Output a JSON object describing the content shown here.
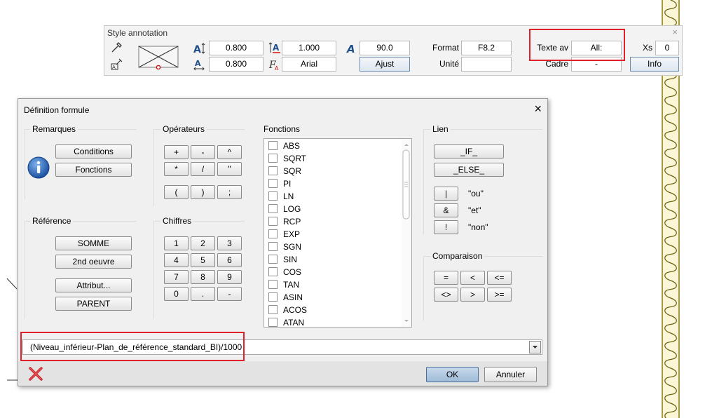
{
  "colors": {
    "highlight": "#e0202a",
    "wave": "#d8c43a",
    "primary_button": "#9fbcd8"
  },
  "style_toolbar": {
    "title": "Style annotation",
    "close_label": "×",
    "text_height": "0.800",
    "text_width": "0.800",
    "line_spacing": "1.000",
    "font": "Arial",
    "angle": "90.0",
    "adjust_button": "Ajust",
    "format_label": "Format",
    "format_value": "F8.2",
    "unit_label": "Unité",
    "unit_value": "",
    "text_before_label": "Texte av",
    "text_before_value": "All:",
    "frame_label": "Cadre",
    "frame_value": "-",
    "xs_label": "Xs",
    "xs_value": "0",
    "info_button": "Info"
  },
  "dialog": {
    "title": "Définition formule",
    "close_label": "×",
    "remarks": {
      "label": "Remarques",
      "conditions_button": "Conditions",
      "functions_button": "Fonctions",
      "info_icon": "info-icon"
    },
    "reference": {
      "label": "Référence",
      "sum_button": "SOMME",
      "second_work_button": "2nd oeuvre",
      "attribute_button": "Attribut...",
      "parent_button": "PARENT"
    },
    "operators": {
      "label": "Opérateurs",
      "buttons": [
        "+",
        "-",
        "^",
        "*",
        "/",
        "\"",
        "(",
        ")",
        ";"
      ]
    },
    "digits": {
      "label": "Chiffres",
      "buttons": [
        "1",
        "2",
        "3",
        "4",
        "5",
        "6",
        "7",
        "8",
        "9",
        "0",
        ".",
        "-"
      ]
    },
    "functions": {
      "label": "Fonctions",
      "items": [
        "ABS",
        "SQRT",
        "SQR",
        "PI",
        "LN",
        "LOG",
        "RCP",
        "EXP",
        "SGN",
        "SIN",
        "COS",
        "TAN",
        "ASIN",
        "ACOS",
        "ATAN"
      ]
    },
    "link": {
      "label": "Lien",
      "if_button": "_IF_",
      "else_button": "_ELSE_",
      "or_button": "|",
      "or_text": "\"ou\"",
      "and_button": "&",
      "and_text": "\"et\"",
      "not_button": "!",
      "not_text": "\"non\""
    },
    "comparison": {
      "label": "Comparaison",
      "buttons": [
        "=",
        "<",
        "<=",
        "<>",
        ">",
        ">="
      ]
    },
    "formula": {
      "value": "(Niveau_inférieur-Plan_de_référence_standard_BI)/1000"
    },
    "footer": {
      "delete_icon": "red-x-icon",
      "ok_button": "OK",
      "cancel_button": "Annuler"
    }
  }
}
